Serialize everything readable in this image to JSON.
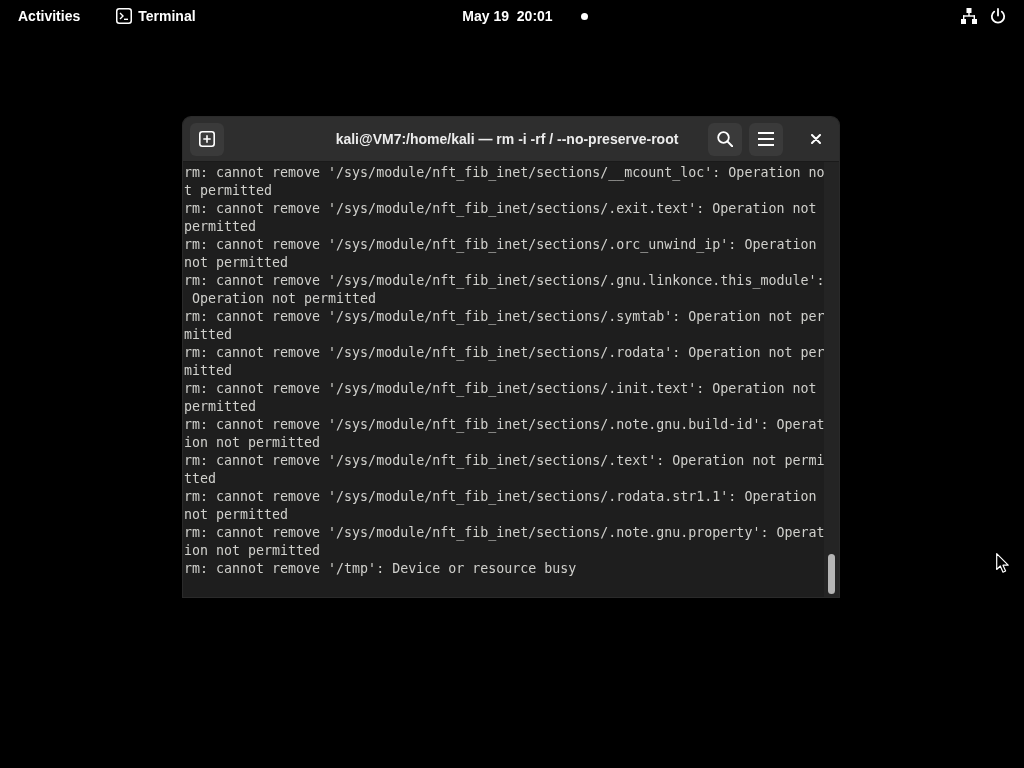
{
  "top_bar": {
    "activities": "Activities",
    "app_menu": "Terminal",
    "clock": "May 19  20:01"
  },
  "window": {
    "title": "kali@VM7:/home/kali — rm -i -rf / --no-preserve-root",
    "lines": [
      "rm: cannot remove '/sys/module/nft_fib_inet/sections/__mcount_loc': Operation no",
      "t permitted",
      "rm: cannot remove '/sys/module/nft_fib_inet/sections/.exit.text': Operation not",
      "permitted",
      "rm: cannot remove '/sys/module/nft_fib_inet/sections/.orc_unwind_ip': Operation",
      "not permitted",
      "rm: cannot remove '/sys/module/nft_fib_inet/sections/.gnu.linkonce.this_module':",
      " Operation not permitted",
      "rm: cannot remove '/sys/module/nft_fib_inet/sections/.symtab': Operation not per",
      "mitted",
      "rm: cannot remove '/sys/module/nft_fib_inet/sections/.rodata': Operation not per",
      "mitted",
      "rm: cannot remove '/sys/module/nft_fib_inet/sections/.init.text': Operation not",
      "permitted",
      "rm: cannot remove '/sys/module/nft_fib_inet/sections/.note.gnu.build-id': Operat",
      "ion not permitted",
      "rm: cannot remove '/sys/module/nft_fib_inet/sections/.text': Operation not permi",
      "tted",
      "rm: cannot remove '/sys/module/nft_fib_inet/sections/.rodata.str1.1': Operation",
      "not permitted",
      "rm: cannot remove '/sys/module/nft_fib_inet/sections/.note.gnu.property': Operat",
      "ion not permitted",
      "rm: cannot remove '/tmp': Device or resource busy"
    ]
  }
}
